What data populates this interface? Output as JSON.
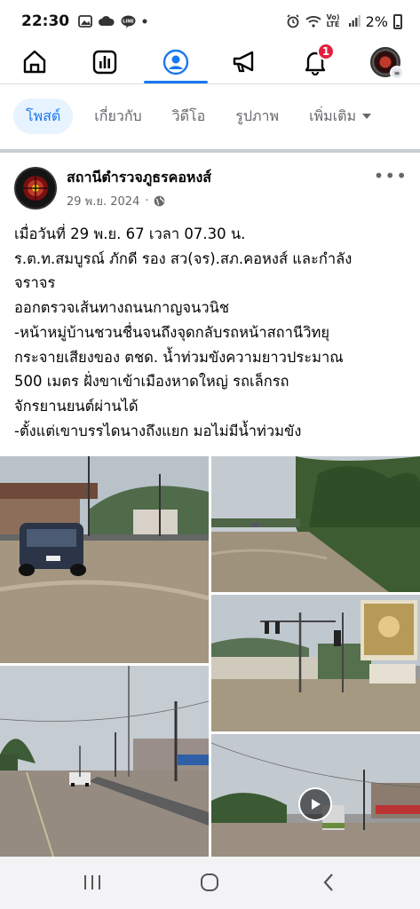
{
  "status_bar": {
    "time": "22:30",
    "battery": "2%",
    "left_icons": [
      "gallery-icon",
      "cloud-icon",
      "line-icon",
      "dot-icon"
    ],
    "right_icons": [
      "alarm-icon",
      "wifi-icon",
      "volte-icon",
      "signal-icon",
      "battery-icon"
    ],
    "volte_label": "Vo) LTE"
  },
  "top_nav": {
    "items": [
      "home-icon",
      "feed-icon",
      "profile-icon",
      "announce-icon",
      "notifications-icon",
      "avatar"
    ],
    "notification_count": "1",
    "accent": "#1877f2",
    "badge_color": "#e41e3f"
  },
  "profile_tabs": [
    {
      "label": "โพสต์",
      "active": true
    },
    {
      "label": "เกี่ยวกับ",
      "active": false
    },
    {
      "label": "วิดีโอ",
      "active": false
    },
    {
      "label": "รูปภาพ",
      "active": false
    },
    {
      "label": "เพิ่มเติม",
      "active": false
    }
  ],
  "post": {
    "author": "สถานีตำรวจภูธรคอหงส์",
    "date": "29 พ.ย. 2024",
    "separator": "·",
    "lines": [
      "เมื่อวันที่ 29  พ.ย. 67 เวลา 07.30 น.",
      "ร.ต.ท.สมบูรณ์ ภักดี รอง สว(จร).สภ.คอหงส์ และกำลัง",
      "จราจร",
      "ออกตรวจเส้นทางถนนกาญจนวนิช",
      "-หน้าหมู่บ้านชวนชื่นจนถึงจุดกลับรถหน้าสถานีวิทยุ",
      "กระจายเสียงของ ตชด. น้ำท่วมขังความยาวประมาณ",
      "500 เมตร  ฝั่งขาเข้าเมืองหาดใหญ่ รถเล็กรถ",
      "จักรยานยนต์ผ่านได้",
      "-ตั้งแต่เขาบรรไดนางถึงแยก มอไม่มีน้ำท่วมขัง"
    ]
  },
  "android_nav": [
    "recent-apps-icon",
    "home-circle-icon",
    "back-icon"
  ]
}
